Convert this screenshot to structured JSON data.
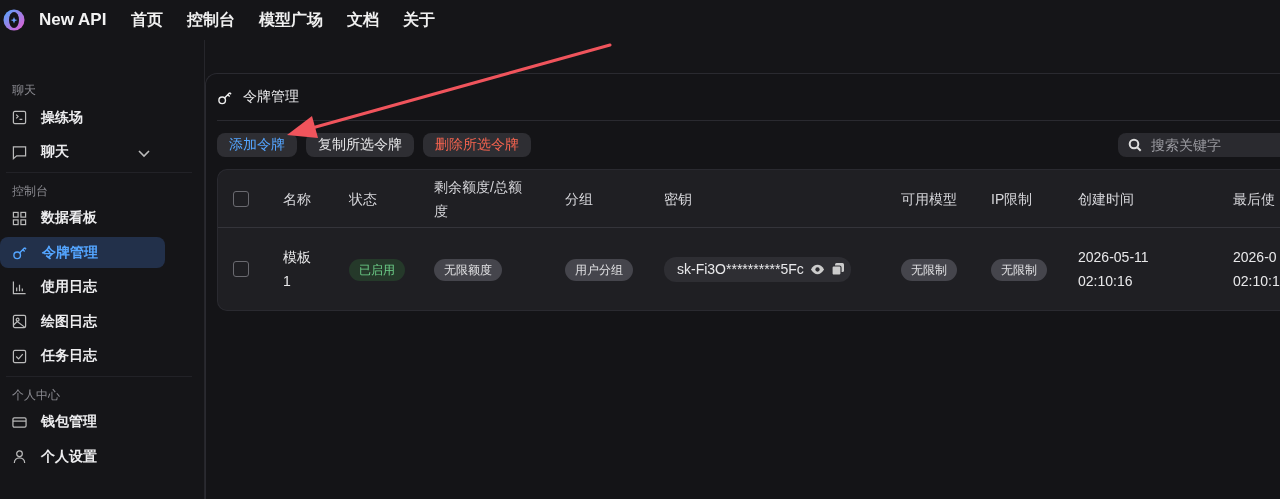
{
  "topbar": {
    "brand": "New API",
    "nav": [
      {
        "label": "首页"
      },
      {
        "label": "控制台"
      },
      {
        "label": "模型广场"
      },
      {
        "label": "文档"
      },
      {
        "label": "关于"
      }
    ]
  },
  "sidebar": {
    "sections": [
      {
        "title": "聊天",
        "items": [
          {
            "label": "操练场",
            "selected": false
          },
          {
            "label": "聊天",
            "selected": false,
            "expanded": false
          }
        ]
      },
      {
        "title": "控制台",
        "items": [
          {
            "label": "数据看板",
            "selected": false
          },
          {
            "label": "令牌管理",
            "selected": true
          },
          {
            "label": "使用日志",
            "selected": false
          },
          {
            "label": "绘图日志",
            "selected": false
          },
          {
            "label": "任务日志",
            "selected": false
          }
        ]
      },
      {
        "title": "个人中心",
        "items": [
          {
            "label": "钱包管理",
            "selected": false
          },
          {
            "label": "个人设置",
            "selected": false
          }
        ]
      }
    ]
  },
  "panel": {
    "title": "令牌管理",
    "buttons": [
      {
        "label": "添加令牌",
        "kind": "primary"
      },
      {
        "label": "复制所选令牌",
        "kind": "default"
      },
      {
        "label": "删除所选令牌",
        "kind": "danger"
      }
    ],
    "search": {
      "placeholder": "搜索关键字"
    },
    "table": {
      "header_checked": false,
      "columns": [
        "名称",
        "状态",
        "剩余额度/总额度",
        "分组",
        "密钥",
        "可用模型",
        "IP限制",
        "创建时间",
        "最后使"
      ],
      "rows": [
        {
          "checked": false,
          "name": "模板 1",
          "status": {
            "text": "已启用",
            "kind": "success"
          },
          "quota": "无限额度",
          "group": "用户分组",
          "key": "sk-Fi3O**********5Fc",
          "models": "无限制",
          "ip": "无限制",
          "created": "2026-05-11 02:10:16",
          "last_used": "2026-0 02:10:1"
        }
      ]
    }
  }
}
